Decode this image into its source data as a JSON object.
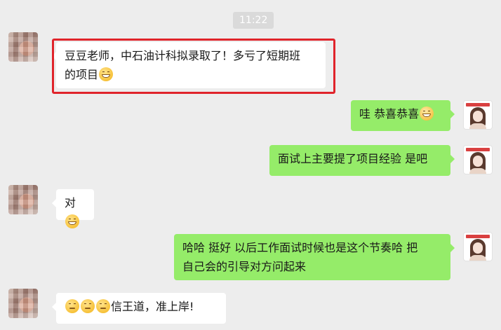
{
  "chat": {
    "time": "11:22",
    "messages": [
      {
        "side": "in",
        "text": "豆豆老师，中石油计科拟录取了！多亏了短期班",
        "text2": "的项目",
        "emoji": "grin-icon"
      },
      {
        "side": "out",
        "text": "哇 恭喜恭喜",
        "emoji": "clapping-icon"
      },
      {
        "side": "out",
        "text": "面试上主要提了项目经验 是吧"
      },
      {
        "side": "in",
        "text": "对",
        "emoji": "grin-icon"
      },
      {
        "side": "out",
        "text": "哈哈 挺好  以后工作面试时候也是这个节奏哈 把",
        "text2": "自己会的引导对方问起来"
      },
      {
        "side": "in",
        "text": "信王道，准上岸!",
        "emoji_prefix": [
          "thinking-icon",
          "thinking-icon",
          "thinking-icon"
        ]
      }
    ]
  },
  "colors": {
    "background": "#ededed",
    "incoming_bubble": "#ffffff",
    "outgoing_bubble": "#95ec69",
    "highlight_border": "#e0242b",
    "time_pill": "#dadada"
  }
}
